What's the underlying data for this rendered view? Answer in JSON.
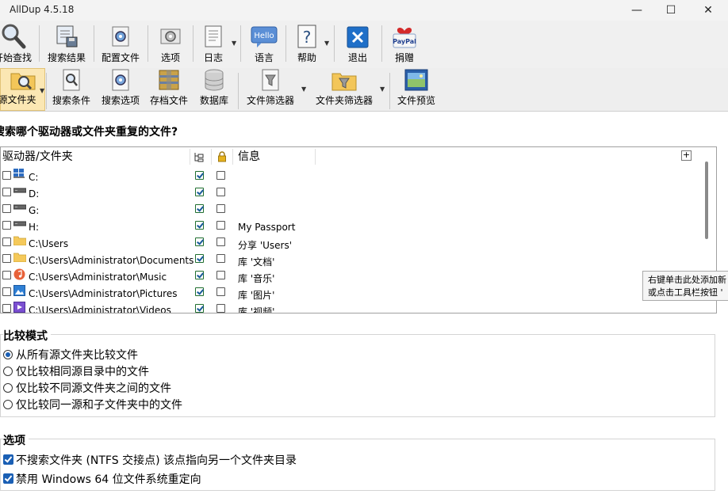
{
  "window": {
    "title": "AllDup 4.5.18",
    "minimize": "—",
    "maximize": "☐",
    "close": "✕"
  },
  "toolbar_main": [
    {
      "label": "开始查找",
      "icon": "magnifier-icon"
    },
    {
      "label": "搜索结果",
      "icon": "results-icon"
    },
    {
      "label": "配置文件",
      "icon": "profile-gear-icon"
    },
    {
      "label": "选项",
      "icon": "options-gear-icon"
    },
    {
      "label": "日志",
      "icon": "log-icon"
    },
    {
      "label": "语言",
      "icon": "hello-icon",
      "icon_text": "Hello"
    },
    {
      "label": "帮助",
      "icon": "help-icon"
    },
    {
      "label": "退出",
      "icon": "exit-icon"
    },
    {
      "label": "捐赠",
      "icon": "paypal-icon",
      "icon_text": "PayPal"
    }
  ],
  "toolbar_sub": [
    {
      "label": "源文件夹",
      "icon": "source-folder-icon"
    },
    {
      "label": "搜索条件",
      "icon": "search-criteria-icon"
    },
    {
      "label": "搜索选项",
      "icon": "search-options-icon"
    },
    {
      "label": "存档文件",
      "icon": "archive-icon"
    },
    {
      "label": "数据库",
      "icon": "database-icon"
    },
    {
      "label": "文件筛选器",
      "icon": "file-filter-icon"
    },
    {
      "label": "文件夹筛选器",
      "icon": "folder-filter-icon"
    },
    {
      "label": "文件预览",
      "icon": "preview-icon"
    }
  ],
  "main": {
    "heading": "搜索哪个驱动器或文件夹重复的文件?",
    "columns": {
      "drive_folder": "驱动器/文件夹",
      "info": "信息",
      "add": "+"
    },
    "rows": [
      {
        "path": "C:",
        "icon": "windows-drive-icon",
        "sub": true,
        "lock": false,
        "info": ""
      },
      {
        "path": "D:",
        "icon": "drive-icon",
        "sub": true,
        "lock": false,
        "info": ""
      },
      {
        "path": "G:",
        "icon": "drive-icon",
        "sub": true,
        "lock": false,
        "info": ""
      },
      {
        "path": "H:",
        "icon": "drive-icon",
        "sub": true,
        "lock": false,
        "info": "My Passport"
      },
      {
        "path": "C:\\Users",
        "icon": "folder-icon",
        "sub": true,
        "lock": false,
        "info": "分享 'Users'"
      },
      {
        "path": "C:\\Users\\Administrator\\Documents",
        "icon": "folder-icon",
        "sub": true,
        "lock": false,
        "info": "库 '文档'"
      },
      {
        "path": "C:\\Users\\Administrator\\Music",
        "icon": "music-icon",
        "sub": true,
        "lock": false,
        "info": "库 '音乐'"
      },
      {
        "path": "C:\\Users\\Administrator\\Pictures",
        "icon": "pictures-icon",
        "sub": true,
        "lock": false,
        "info": "库 '图片'"
      },
      {
        "path": "C:\\Users\\Administrator\\Videos",
        "icon": "videos-icon",
        "sub": true,
        "lock": false,
        "info": "库 '视频'"
      }
    ],
    "tooltip": {
      "line1": "右键单击此处添加新",
      "line2": "或点击工具栏按钮 '"
    }
  },
  "compare_mode": {
    "title": "比较模式",
    "options": [
      {
        "label": "从所有源文件夹比较文件",
        "selected": true
      },
      {
        "label": "仅比较相同源目录中的文件",
        "selected": false
      },
      {
        "label": "仅比较不同源文件夹之间的文件",
        "selected": false
      },
      {
        "label": "仅比较同一源和子文件夹中的文件",
        "selected": false
      }
    ]
  },
  "options": {
    "title": "选项",
    "items": [
      {
        "label": "不搜索文件夹 (NTFS 交接点) 该点指向另一个文件夹目录",
        "checked": true
      },
      {
        "label": "禁用 Windows 64 位文件系统重定向",
        "checked": true
      }
    ]
  }
}
